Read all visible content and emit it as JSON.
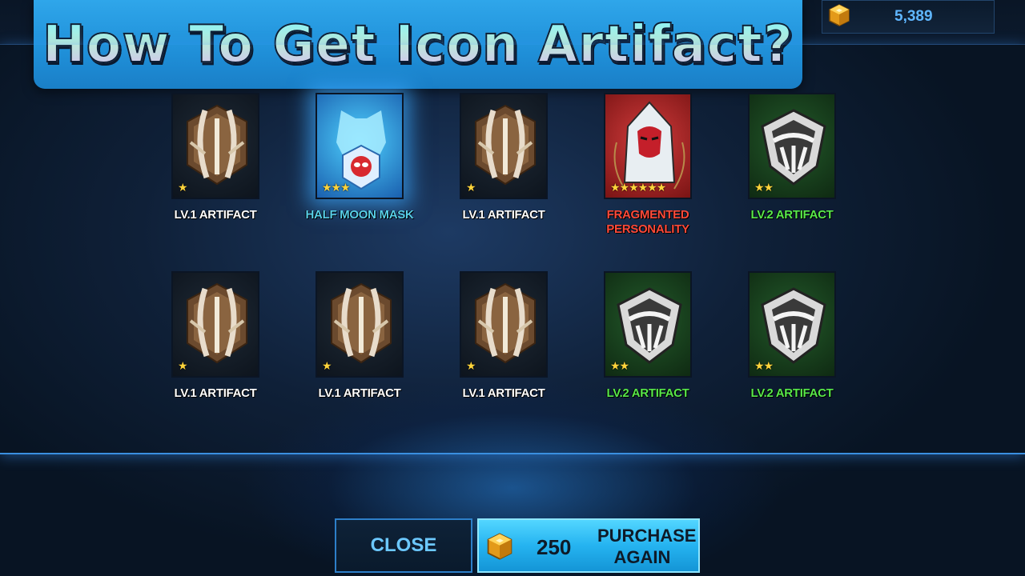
{
  "banner": {
    "title": "How To Get Icon Artifact?"
  },
  "currency": {
    "amount": "5,389",
    "icon": "gold-cube-icon"
  },
  "rewards": [
    {
      "label": "LV.1 ARTIFACT",
      "stars": "★",
      "rarity": "bronze",
      "label_color": "white",
      "icon": "lv1-artifact-icon"
    },
    {
      "label": "HALF MOON MASK",
      "stars": "★★★",
      "rarity": "blue",
      "label_color": "blue",
      "icon": "half-moon-mask-icon"
    },
    {
      "label": "LV.1 ARTIFACT",
      "stars": "★",
      "rarity": "bronze",
      "label_color": "white",
      "icon": "lv1-artifact-icon"
    },
    {
      "label": "FRAGMENTED\nPERSONALITY",
      "stars": "★★★★★★",
      "rarity": "red",
      "label_color": "red",
      "icon": "fragmented-personality-icon"
    },
    {
      "label": "LV.2 ARTIFACT",
      "stars": "★★",
      "rarity": "green",
      "label_color": "green",
      "icon": "lv2-artifact-icon"
    },
    {
      "label": "LV.1 ARTIFACT",
      "stars": "★",
      "rarity": "bronze",
      "label_color": "white",
      "icon": "lv1-artifact-icon"
    },
    {
      "label": "LV.1 ARTIFACT",
      "stars": "★",
      "rarity": "bronze",
      "label_color": "white",
      "icon": "lv1-artifact-icon"
    },
    {
      "label": "LV.1 ARTIFACT",
      "stars": "★",
      "rarity": "bronze",
      "label_color": "white",
      "icon": "lv1-artifact-icon"
    },
    {
      "label": "LV.2 ARTIFACT",
      "stars": "★★",
      "rarity": "green",
      "label_color": "green",
      "icon": "lv2-artifact-icon"
    },
    {
      "label": "LV.2 ARTIFACT",
      "stars": "★★",
      "rarity": "green",
      "label_color": "green",
      "icon": "lv2-artifact-icon"
    }
  ],
  "buttons": {
    "close": "CLOSE",
    "purchase_price": "250",
    "purchase_label_line1": "PURCHASE",
    "purchase_label_line2": "AGAIN"
  },
  "colors": {
    "accent_blue": "#2fa6ea",
    "label_white": "#ffffff",
    "label_green": "#58e84a",
    "label_blue": "#58cfe8",
    "label_red": "#ff4a3a",
    "star_gold": "#ffd43b"
  }
}
